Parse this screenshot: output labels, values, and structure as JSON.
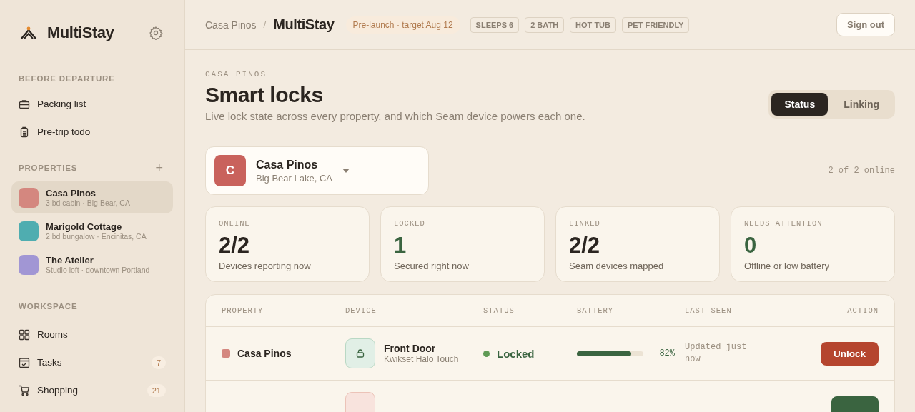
{
  "sidebar": {
    "brand": "MultiStay",
    "sections": [
      {
        "title": "BEFORE DEPARTURE",
        "items": [
          {
            "label": "Packing list",
            "kind": "bag"
          },
          {
            "label": "Pre-trip todo",
            "kind": "clipboard"
          }
        ]
      }
    ],
    "properties_title": "PROPERTIES",
    "add_label": "+",
    "properties": [
      {
        "name": "Casa Pinos",
        "detail": "3 bd cabin · Big Bear, CA",
        "color": "#d4877f",
        "selected": true
      },
      {
        "name": "Marigold Cottage",
        "detail": "2 bd bungalow · Encinitas, CA",
        "color": "#4fadb0",
        "selected": false
      },
      {
        "name": "The Atelier",
        "detail": "Studio loft · downtown Portland",
        "color": "#a196d4",
        "selected": false
      }
    ],
    "workspace_title": "WORKSPACE",
    "workspace": [
      {
        "label": "Rooms",
        "kind": "grid"
      },
      {
        "label": "Tasks",
        "kind": "calendar",
        "count": "7"
      },
      {
        "label": "Shopping",
        "kind": "cart",
        "count": "21"
      }
    ]
  },
  "header": {
    "breadcrumb": "Casa Pinos",
    "separator": "/",
    "title": "MultiStay",
    "status": "Pre-launch · target Aug 12",
    "tags": [
      "SLEEPS 6",
      "2 BATH",
      "HOT TUB",
      "PET FRIENDLY"
    ],
    "sign_out": "Sign out"
  },
  "page": {
    "eyebrow": "CASA PINOS",
    "title": "Smart locks",
    "subtitle": "Live lock state across every property, and which Seam device powers each one.",
    "views": [
      {
        "label": "Status",
        "selected": true
      },
      {
        "label": "Linking",
        "selected": false
      }
    ],
    "picker": {
      "initial": "C",
      "name": "Casa Pinos",
      "location": "Big Bear Lake, CA"
    },
    "online_summary": "2 of 2 online",
    "stats": [
      {
        "label": "ONLINE",
        "value": "2/2",
        "note": "Devices reporting now",
        "color": "#2b2520"
      },
      {
        "label": "LOCKED",
        "value": "1",
        "note": "Secured right now",
        "color": "#3a6440"
      },
      {
        "label": "LINKED",
        "value": "2/2",
        "note": "Seam devices mapped",
        "color": "#2b2520"
      },
      {
        "label": "NEEDS ATTENTION",
        "value": "0",
        "note": "Offline or low battery",
        "color": "#3a6440"
      }
    ],
    "table": {
      "columns": [
        "PROPERTY",
        "DEVICE",
        "STATUS",
        "BATTERY",
        "LAST SEEN",
        "ACTION"
      ],
      "rows": [
        {
          "kind": "full",
          "property": "Casa Pinos",
          "color": "#d4877f",
          "device": "Front Door",
          "model": "Kwikset Halo Touch",
          "status": "Locked",
          "locked": true,
          "level": 0.82,
          "battery": "82%",
          "last_seen": "Updated just now",
          "action": "Unlock"
        },
        {
          "kind": "clipped",
          "locked": false
        }
      ]
    }
  }
}
